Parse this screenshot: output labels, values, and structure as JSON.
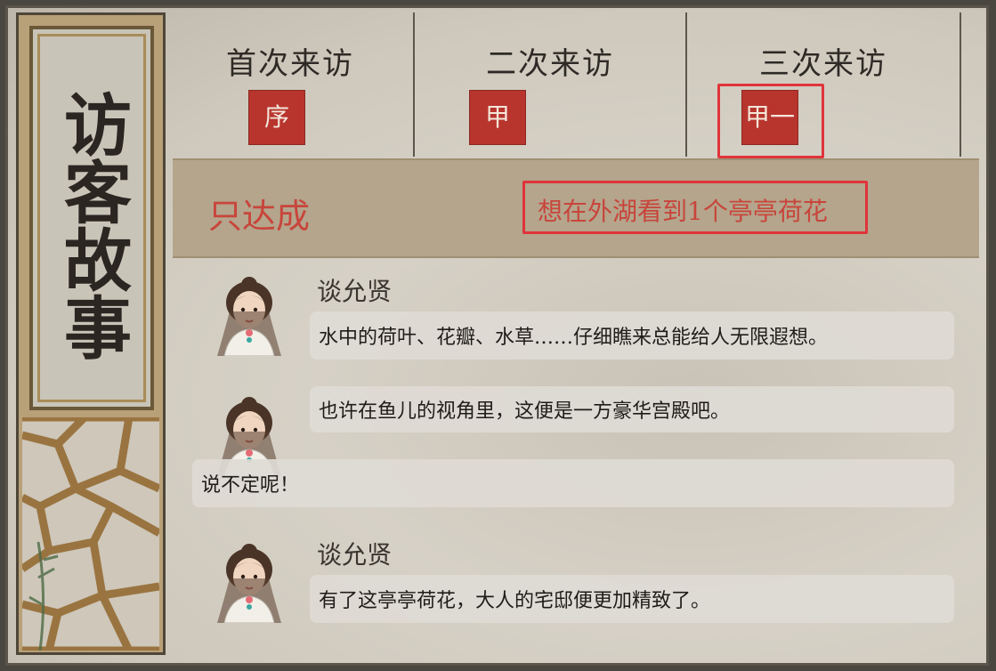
{
  "sidebar": {
    "title": "访客故事"
  },
  "visits": [
    {
      "title": "首次来访",
      "stamp": "序"
    },
    {
      "title": "二次来访",
      "stamp": "甲"
    },
    {
      "title": "三次来访",
      "stamp": "甲一"
    }
  ],
  "goal": {
    "prefix": "只达成",
    "text": "想在外湖看到1个亭亭荷花"
  },
  "dialog": [
    {
      "speaker": "谈允贤",
      "text": "水中的荷叶、花瓣、水草……仔细瞧来总能给人无限遐想。"
    },
    {
      "speaker": "",
      "text": "也许在鱼儿的视角里，这便是一方豪华宫殿吧。"
    },
    {
      "speaker": "",
      "text": "说不定呢！"
    },
    {
      "speaker": "谈允贤",
      "text": "有了这亭亭荷花，大人的宅邸便更加精致了。"
    }
  ],
  "colors": {
    "stamp": "#b8352e",
    "highlight": "#e0343a",
    "goal_text": "#c8453b"
  }
}
